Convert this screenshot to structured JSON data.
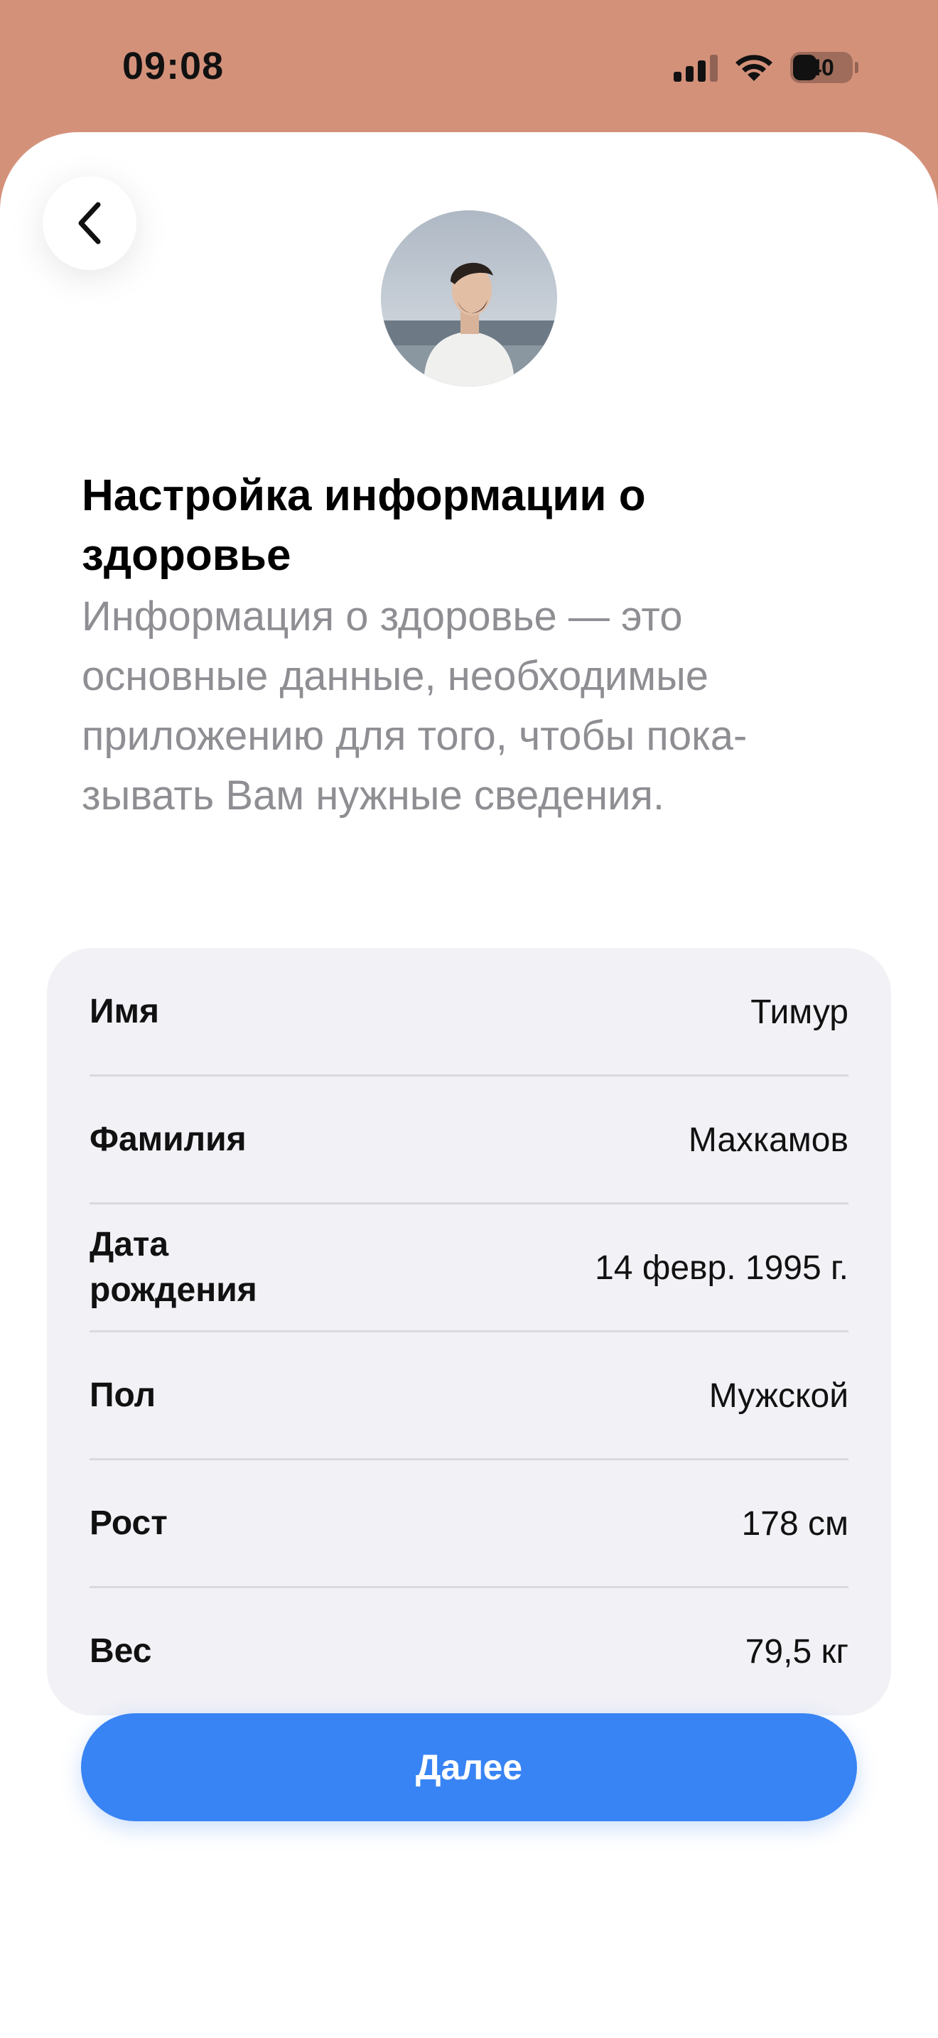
{
  "status_bar": {
    "time": "09:08",
    "battery": "40"
  },
  "header": {
    "title": "Настройка информации о здоровье",
    "description": "Информация о здоровье — это основные данные, необходимые приложению для того, чтобы пока-зывать Вам нужные сведения."
  },
  "health_info": [
    {
      "label": "Имя",
      "value": "Тимур"
    },
    {
      "label": "Фамилия",
      "value": "Махкамов"
    },
    {
      "label": "Дата рождения",
      "value": "14 февр. 1995 г."
    },
    {
      "label": "Пол",
      "value": "Мужской"
    },
    {
      "label": "Рост",
      "value": "178 см"
    },
    {
      "label": "Вес",
      "value": "79,5 кг"
    }
  ],
  "footer": {
    "next_label": "Далее"
  },
  "colors": {
    "header_bg": "#d4917a",
    "accent": "#3884f4",
    "card_bg": "#f1f1f6",
    "secondary_text": "#8e8e93"
  }
}
